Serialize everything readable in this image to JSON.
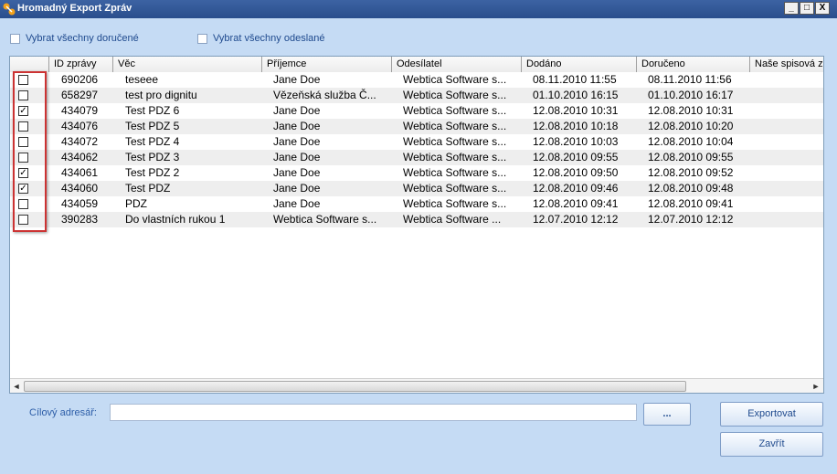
{
  "window": {
    "title": "Hromadný Export Zpráv",
    "controls": {
      "minimize": "_",
      "maximize": "□",
      "close": "X"
    }
  },
  "options": {
    "select_received": "Vybrat všechny doručené",
    "select_sent": "Vybrat všechny odeslané"
  },
  "grid": {
    "columns": [
      "ID zprávy",
      "Věc",
      "Příjemce",
      "Odesílatel",
      "Dodáno",
      "Doručeno",
      "Naše spisová zn"
    ],
    "rows": [
      {
        "checked": false,
        "id": "690206",
        "subject": "teseee",
        "recipient": "Jane Doe",
        "sender": "Webtica Software s...",
        "delivered": "08.11.2010 11:55",
        "received": "08.11.2010 11:56"
      },
      {
        "checked": false,
        "id": "658297",
        "subject": "test pro dignitu",
        "recipient": "Vězeňská služba Č...",
        "sender": "Webtica Software s...",
        "delivered": "01.10.2010 16:15",
        "received": "01.10.2010 16:17"
      },
      {
        "checked": true,
        "id": "434079",
        "subject": "Test PDZ 6",
        "recipient": "Jane Doe",
        "sender": "Webtica Software s...",
        "delivered": "12.08.2010 10:31",
        "received": "12.08.2010 10:31"
      },
      {
        "checked": false,
        "id": "434076",
        "subject": "Test PDZ 5",
        "recipient": "Jane Doe",
        "sender": "Webtica Software s...",
        "delivered": "12.08.2010 10:18",
        "received": "12.08.2010 10:20"
      },
      {
        "checked": false,
        "id": "434072",
        "subject": "Test PDZ 4",
        "recipient": "Jane Doe",
        "sender": "Webtica Software s...",
        "delivered": "12.08.2010 10:03",
        "received": "12.08.2010 10:04"
      },
      {
        "checked": false,
        "id": "434062",
        "subject": "Test PDZ 3",
        "recipient": "Jane Doe",
        "sender": "Webtica Software s...",
        "delivered": "12.08.2010 09:55",
        "received": "12.08.2010 09:55"
      },
      {
        "checked": true,
        "id": "434061",
        "subject": "Test PDZ 2",
        "recipient": "Jane Doe",
        "sender": "Webtica Software s...",
        "delivered": "12.08.2010 09:50",
        "received": "12.08.2010 09:52"
      },
      {
        "checked": true,
        "id": "434060",
        "subject": "Test PDZ",
        "recipient": "Jane Doe",
        "sender": "Webtica Software s...",
        "delivered": "12.08.2010 09:46",
        "received": "12.08.2010 09:48"
      },
      {
        "checked": false,
        "id": "434059",
        "subject": "PDZ",
        "recipient": "Jane Doe",
        "sender": "Webtica Software s...",
        "delivered": "12.08.2010 09:41",
        "received": "12.08.2010 09:41"
      },
      {
        "checked": false,
        "id": "390283",
        "subject": "Do vlastních rukou 1",
        "recipient": "Webtica Software s...",
        "sender": "Webtica Software ...",
        "delivered": "12.07.2010 12:12",
        "received": "12.07.2010 12:12"
      }
    ],
    "scroll_left": "◄",
    "scroll_right": "►"
  },
  "target": {
    "label": "Cílový adresář:",
    "value": "",
    "browse_label": "..."
  },
  "buttons": {
    "export": "Exportovat",
    "close": "Zavřít"
  },
  "colors": {
    "titlebar": "#2a4e8c",
    "background": "#c5dbf4",
    "label_text": "#1f4a8e",
    "highlight": "#cc3333"
  }
}
